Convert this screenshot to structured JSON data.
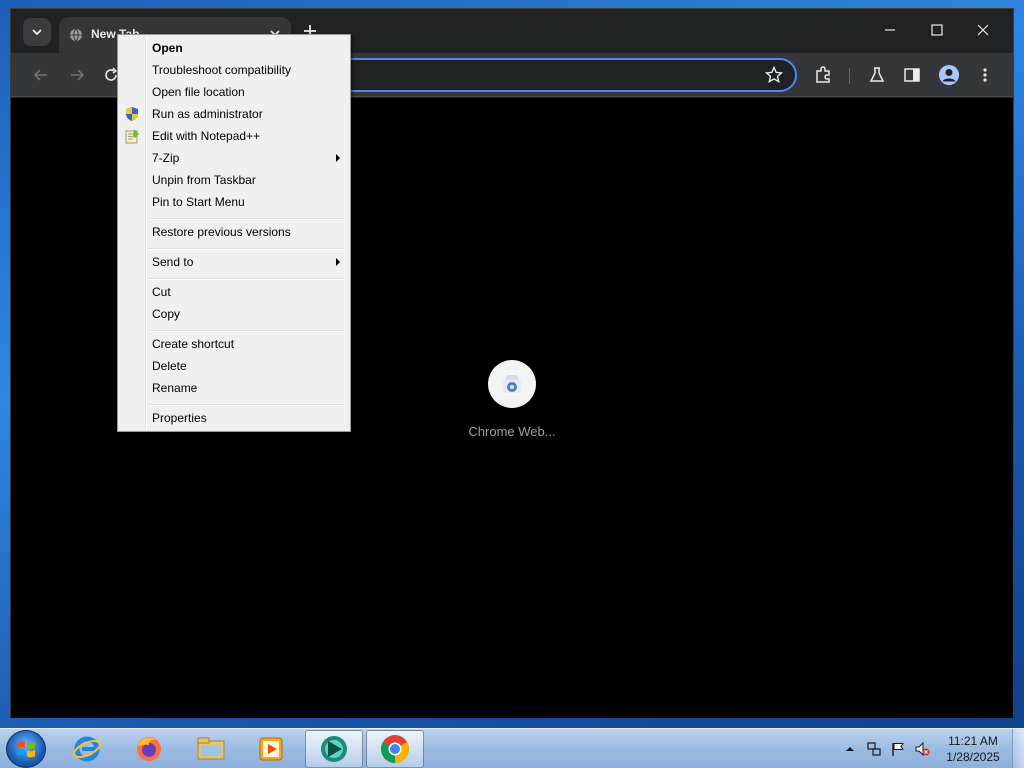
{
  "browser": {
    "tab_title": "New Tab",
    "omnibox_placeholder": "",
    "shortcut_label": "Chrome Web..."
  },
  "context_menu": {
    "items": [
      {
        "label": "Open"
      },
      {
        "label": "Troubleshoot compatibility"
      },
      {
        "label": "Open file location"
      },
      {
        "label": "Run as administrator"
      },
      {
        "label": "Edit with Notepad++"
      },
      {
        "label": "7-Zip"
      },
      {
        "label": "Unpin from Taskbar"
      },
      {
        "label": "Pin to Start Menu"
      },
      {
        "label": "Restore previous versions"
      },
      {
        "label": "Send to"
      },
      {
        "label": "Cut"
      },
      {
        "label": "Copy"
      },
      {
        "label": "Create shortcut"
      },
      {
        "label": "Delete"
      },
      {
        "label": "Rename"
      },
      {
        "label": "Properties"
      }
    ]
  },
  "taskbar": {
    "apps": [
      "internet-explorer",
      "firefox",
      "file-explorer",
      "media-player",
      "browser-app",
      "chrome"
    ],
    "clock_time": "11:21 AM",
    "clock_date": "1/28/2025"
  },
  "colors": {
    "accent": "#4a89f0",
    "chrome_dark": "#202124",
    "toolbar": "#35363a",
    "menu_bg": "#f0f0f0"
  }
}
